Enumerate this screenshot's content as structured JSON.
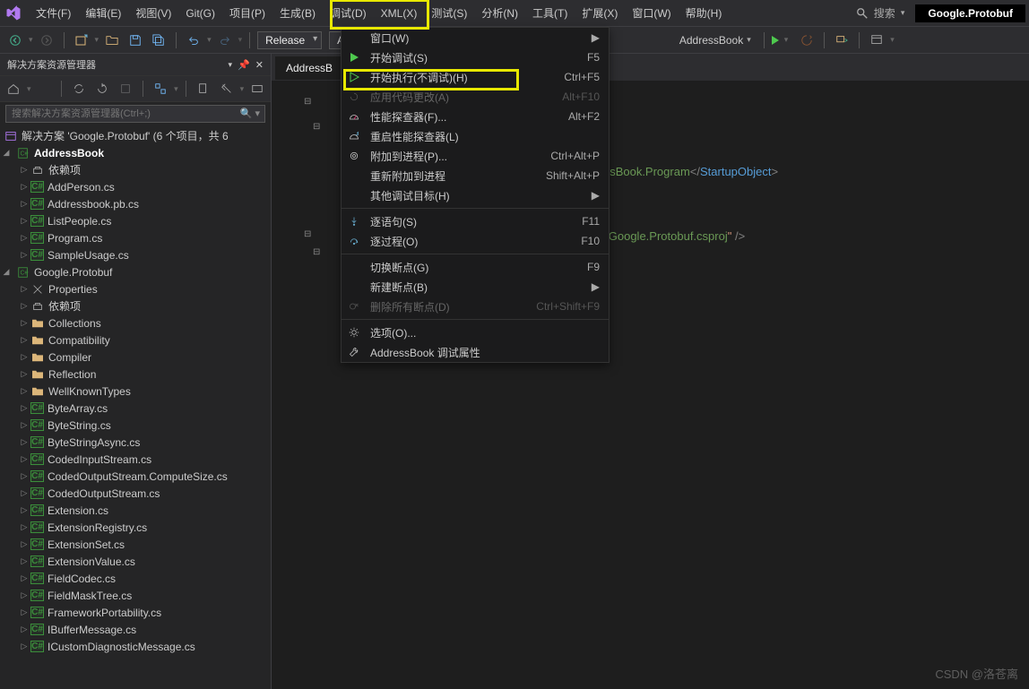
{
  "titlebar": {
    "menus": [
      "文件(F)",
      "编辑(E)",
      "视图(V)",
      "Git(G)",
      "项目(P)",
      "生成(B)",
      "调试(D)",
      "XML(X)",
      "测试(S)",
      "分析(N)",
      "工具(T)",
      "扩展(X)",
      "窗口(W)",
      "帮助(H)"
    ],
    "search": "搜索",
    "solution": "Google.Protobuf"
  },
  "toolbar": {
    "config": "Release",
    "platform": "Any C",
    "target": "AddressBook"
  },
  "explorer": {
    "title": "解决方案资源管理器",
    "search_placeholder": "搜索解决方案资源管理器(Ctrl+;)",
    "solution_label": "解决方案 'Google.Protobuf' (6 个项目，共 6",
    "proj1": {
      "name": "AddressBook",
      "items": [
        "依赖项",
        "AddPerson.cs",
        "Addressbook.pb.cs",
        "ListPeople.cs",
        "Program.cs",
        "SampleUsage.cs"
      ]
    },
    "proj2": {
      "name": "Google.Protobuf",
      "folders": [
        "Properties",
        "依赖项",
        "Collections",
        "Compatibility",
        "Compiler",
        "Reflection",
        "WellKnownTypes"
      ],
      "files": [
        "ByteArray.cs",
        "ByteString.cs",
        "ByteStringAsync.cs",
        "CodedInputStream.cs",
        "CodedOutputStream.ComputeSize.cs",
        "CodedOutputStream.cs",
        "Extension.cs",
        "ExtensionRegistry.cs",
        "ExtensionSet.cs",
        "ExtensionValue.cs",
        "FieldCodec.cs",
        "FieldMaskTree.cs",
        "FrameworkPortability.cs",
        "IBufferMessage.cs",
        "ICustomDiagnosticMessage.cs"
      ]
    }
  },
  "editor": {
    "tab": "AddressB",
    "code_text1": "AddressBook.Program",
    "code_tag1": "StartupObject",
    "code_text2": "otobuf\\Google.Protobuf.csproj",
    "code_attr_end": "\" />"
  },
  "debugmenu": {
    "items": [
      {
        "label": "窗口(W)",
        "shortcut": "",
        "sub": true
      },
      {
        "label": "开始调试(S)",
        "shortcut": "F5",
        "icon": "play"
      },
      {
        "label": "开始执行(不调试)(H)",
        "shortcut": "Ctrl+F5",
        "icon": "play-outline",
        "hl": true
      },
      {
        "label": "应用代码更改(A)",
        "shortcut": "Alt+F10",
        "disabled": true,
        "icon": "reload"
      },
      {
        "label": "性能探查器(F)...",
        "shortcut": "Alt+F2",
        "icon": "meter"
      },
      {
        "label": "重启性能探查器(L)",
        "shortcut": "",
        "icon": "meter-reload"
      },
      {
        "label": "附加到进程(P)...",
        "shortcut": "Ctrl+Alt+P",
        "icon": "attach"
      },
      {
        "label": "重新附加到进程",
        "shortcut": "Shift+Alt+P"
      },
      {
        "label": "其他调试目标(H)",
        "shortcut": "",
        "sub": true
      },
      {
        "sep": true
      },
      {
        "label": "逐语句(S)",
        "shortcut": "F11",
        "icon": "step-into"
      },
      {
        "label": "逐过程(O)",
        "shortcut": "F10",
        "icon": "step-over"
      },
      {
        "sep": true
      },
      {
        "label": "切换断点(G)",
        "shortcut": "F9"
      },
      {
        "label": "新建断点(B)",
        "shortcut": "",
        "sub": true
      },
      {
        "label": "删除所有断点(D)",
        "shortcut": "Ctrl+Shift+F9",
        "disabled": true,
        "icon": "bp-clear"
      },
      {
        "sep": true
      },
      {
        "label": "选项(O)...",
        "shortcut": "",
        "icon": "gear"
      },
      {
        "label": "AddressBook 调试属性",
        "shortcut": "",
        "icon": "wrench"
      }
    ]
  },
  "watermark": "CSDN @洛苍离"
}
